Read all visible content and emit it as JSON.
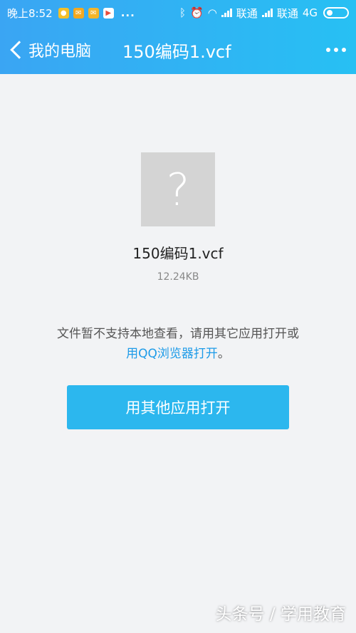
{
  "statusbar": {
    "time": "晚上8:52",
    "more_dots": "...",
    "carrier1": "联通",
    "carrier2": "联通",
    "network": "4G"
  },
  "navbar": {
    "back_label": "我的电脑",
    "title": "150编码1.vcf",
    "icons": {
      "back": "chevron-left-icon",
      "more": "more-dots-icon"
    }
  },
  "file": {
    "icon": "question-mark-icon",
    "icon_glyph": "?",
    "name": "150编码1.vcf",
    "size": "12.24KB"
  },
  "message": {
    "text": "文件暂不支持本地查看，请用其它应用打开或",
    "link": "用QQ浏览器打开",
    "suffix": "。"
  },
  "open_button": {
    "label": "用其他应用打开"
  },
  "watermark": "头条号 / 学用教育",
  "colors": {
    "header_start": "#3aa5f3",
    "header_end": "#27c0f3",
    "button": "#2cb7ee",
    "link": "#1d9be8",
    "background": "#f2f3f5",
    "file_icon_bg": "#d4d4d4"
  }
}
